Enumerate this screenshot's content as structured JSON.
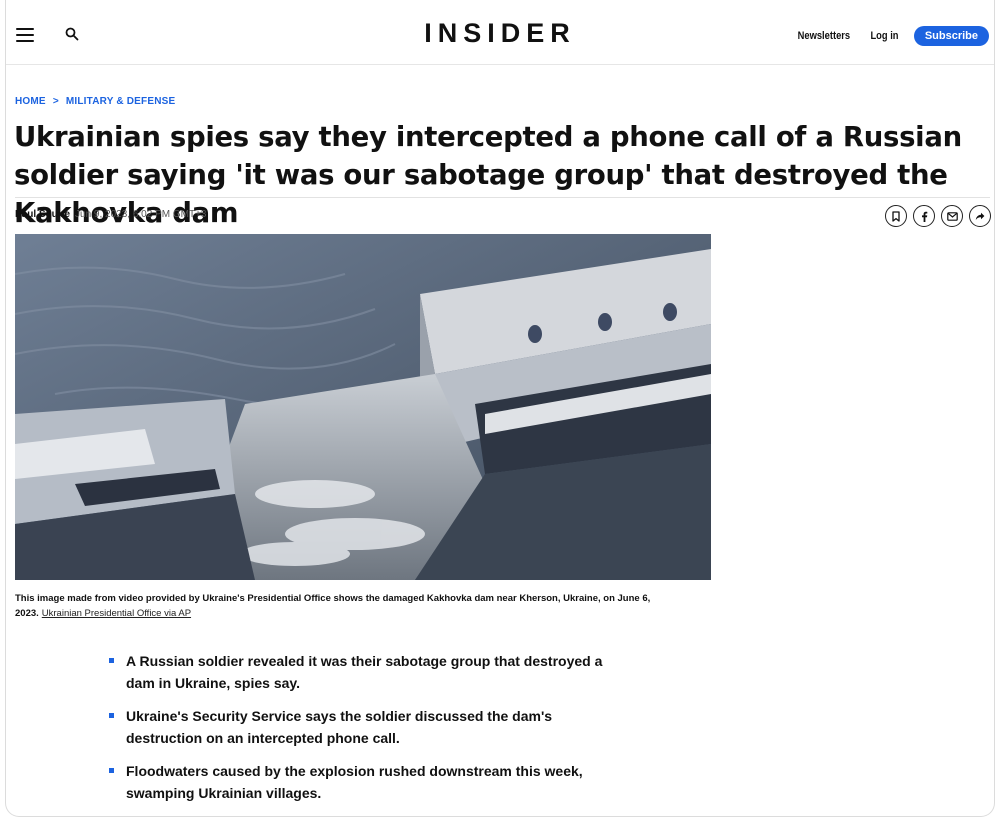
{
  "header": {
    "logo": "INSIDER",
    "newsletters_label": "Newsletters",
    "login_label": "Log in",
    "subscribe_label": "Subscribe"
  },
  "breadcrumb": {
    "items": [
      "HOME",
      "MILITARY & DEFENSE"
    ],
    "separator": ">"
  },
  "article": {
    "title": "Ukrainian spies say they intercepted a phone call of a Russian soldier saying 'it was our sabotage group' that destroyed the Kakhovka dam",
    "author": "Paul Squire",
    "date": "Jun 9, 2023, 6:02 PM GMT+3",
    "caption_text": "This image made from video provided by Ukraine's Presidential Office shows the damaged Kakhovka dam near Kherson, Ukraine, on June 6, 2023.",
    "caption_credit": "Ukrainian Presidential Office via AP",
    "bullets": [
      "A Russian soldier revealed it was their sabotage group that destroyed a dam in Ukraine, spies say.",
      "Ukraine's Security Service says the soldier discussed the dam's destruction on an intercepted phone call.",
      "Floodwaters caused by the explosion rushed downstream this week, swamping Ukrainian villages."
    ]
  },
  "share_icons": [
    "bookmark-icon",
    "facebook-icon",
    "email-icon",
    "share-icon"
  ],
  "colors": {
    "accent": "#1c63e0",
    "text": "#111111"
  }
}
